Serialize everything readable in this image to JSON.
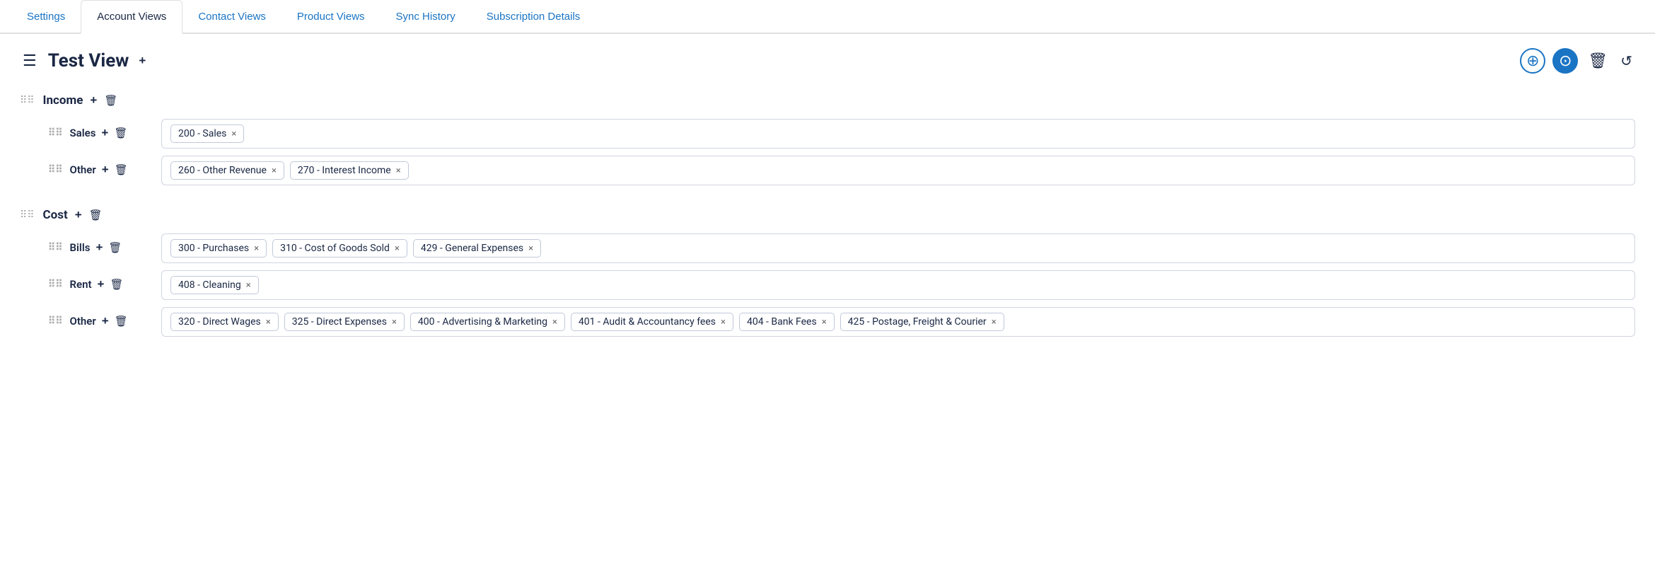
{
  "tabs": [
    {
      "id": "settings",
      "label": "Settings",
      "active": false
    },
    {
      "id": "account-views",
      "label": "Account Views",
      "active": true
    },
    {
      "id": "contact-views",
      "label": "Contact Views",
      "active": false
    },
    {
      "id": "product-views",
      "label": "Product Views",
      "active": false
    },
    {
      "id": "sync-history",
      "label": "Sync History",
      "active": false
    },
    {
      "id": "subscription-details",
      "label": "Subscription Details",
      "active": false
    }
  ],
  "page": {
    "title": "Test View",
    "add_label": "+",
    "toolbar": {
      "upload_icon": "⊕",
      "download_icon": "⊙",
      "delete_icon": "🗑",
      "refresh_icon": "↺"
    }
  },
  "sections": [
    {
      "id": "income",
      "title": "Income",
      "subsections": [
        {
          "id": "sales",
          "label": "Sales",
          "tags": [
            {
              "id": "200",
              "label": "200 - Sales"
            }
          ]
        },
        {
          "id": "other-income",
          "label": "Other",
          "tags": [
            {
              "id": "260",
              "label": "260 - Other Revenue"
            },
            {
              "id": "270",
              "label": "270 - Interest Income"
            }
          ]
        }
      ]
    },
    {
      "id": "cost",
      "title": "Cost",
      "subsections": [
        {
          "id": "bills",
          "label": "Bills",
          "tags": [
            {
              "id": "300",
              "label": "300 - Purchases"
            },
            {
              "id": "310",
              "label": "310 - Cost of Goods Sold"
            },
            {
              "id": "429",
              "label": "429 - General Expenses"
            }
          ]
        },
        {
          "id": "rent",
          "label": "Rent",
          "tags": [
            {
              "id": "408",
              "label": "408 - Cleaning"
            }
          ]
        },
        {
          "id": "other-cost",
          "label": "Other",
          "tags": [
            {
              "id": "320",
              "label": "320 - Direct Wages"
            },
            {
              "id": "325",
              "label": "325 - Direct Expenses"
            },
            {
              "id": "400",
              "label": "400 - Advertising & Marketing"
            },
            {
              "id": "401",
              "label": "401 - Audit & Accountancy fees"
            },
            {
              "id": "404",
              "label": "404 - Bank Fees"
            },
            {
              "id": "425",
              "label": "425 - Postage, Freight & Courier"
            }
          ]
        }
      ]
    }
  ],
  "icons": {
    "drag": "⠿",
    "add": "+",
    "delete": "🗑",
    "close": "×",
    "list": "☰"
  }
}
